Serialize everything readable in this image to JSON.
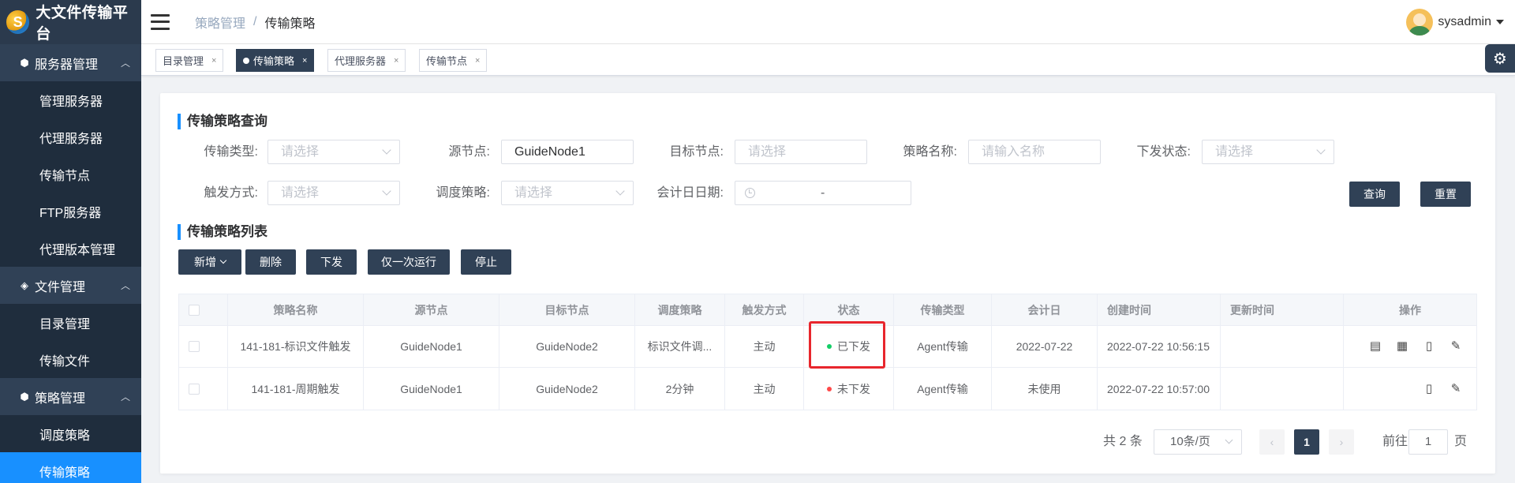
{
  "app": {
    "title": "大文件传输平台",
    "logo_icon": "logo-icon"
  },
  "sidebar": {
    "groups": [
      {
        "label": "服务器管理",
        "icon": "box-icon",
        "items": [
          "管理服务器",
          "代理服务器",
          "传输节点",
          "FTP服务器",
          "代理版本管理"
        ]
      },
      {
        "label": "文件管理",
        "icon": "layers-icon",
        "items": [
          "目录管理",
          "传输文件"
        ]
      },
      {
        "label": "策略管理",
        "icon": "box-icon",
        "items": [
          "调度策略",
          "传输策略"
        ]
      }
    ],
    "active_item": "传输策略"
  },
  "header": {
    "breadcrumb": [
      "策略管理",
      "传输策略"
    ],
    "separator": "/",
    "user": "sysadmin"
  },
  "tags": [
    {
      "label": "目录管理",
      "active": false
    },
    {
      "label": "传输策略",
      "active": true
    },
    {
      "label": "代理服务器",
      "active": false
    },
    {
      "label": "传输节点",
      "active": false
    }
  ],
  "tag_close": "×",
  "query": {
    "title": "传输策略查询",
    "fields": {
      "transfer_type": {
        "label": "传输类型:",
        "placeholder": "请选择"
      },
      "source_node": {
        "label": "源节点:",
        "value": "GuideNode1"
      },
      "target_node": {
        "label": "目标节点:",
        "placeholder": "请选择"
      },
      "policy_name": {
        "label": "策略名称:",
        "placeholder": "请输入名称"
      },
      "issue_status": {
        "label": "下发状态:",
        "placeholder": "请选择"
      },
      "trigger_mode": {
        "label": "触发方式:",
        "placeholder": "请选择"
      },
      "schedule_policy": {
        "label": "调度策略:",
        "placeholder": "请选择"
      },
      "accounting_date": {
        "label": "会计日日期:",
        "separator": "-"
      }
    },
    "search_label": "查询",
    "reset_label": "重置"
  },
  "list": {
    "title": "传输策略列表",
    "actions": {
      "add": "新增",
      "delete": "删除",
      "issue": "下发",
      "run_once": "仅一次运行",
      "stop": "停止"
    },
    "columns": [
      "策略名称",
      "源节点",
      "目标节点",
      "调度策略",
      "触发方式",
      "状态",
      "传输类型",
      "会计日",
      "创建时间",
      "更新时间",
      "操作"
    ],
    "rows": [
      {
        "name": "141-181-标识文件触发",
        "source": "GuideNode1",
        "target": "GuideNode2",
        "schedule": "标识文件调...",
        "trigger": "主动",
        "status": "已下发",
        "status_color": "#13ce66",
        "type": "Agent传输",
        "acct_day": "2022-07-22",
        "created": "2022-07-22 10:56:15",
        "updated": "",
        "ops": [
          "file-settings-icon",
          "calendar-icon",
          "notebook-icon",
          "edit-icon"
        ]
      },
      {
        "name": "141-181-周期触发",
        "source": "GuideNode1",
        "target": "GuideNode2",
        "schedule": "2分钟",
        "trigger": "主动",
        "status": "未下发",
        "status_color": "#ff4949",
        "type": "Agent传输",
        "acct_day": "未使用",
        "created": "2022-07-22 10:57:00",
        "updated": "",
        "ops": [
          "notebook-icon",
          "edit-icon"
        ]
      }
    ]
  },
  "pagination": {
    "total": "共 2 条",
    "page_size": "10条/页",
    "current_page": "1",
    "goto_label": "前往",
    "goto_value": "1",
    "goto_suffix": "页"
  },
  "colors": {
    "sidebar_bg": "#304156",
    "accent": "#1890ff",
    "button": "#304156",
    "highlight": "#e8262d"
  }
}
